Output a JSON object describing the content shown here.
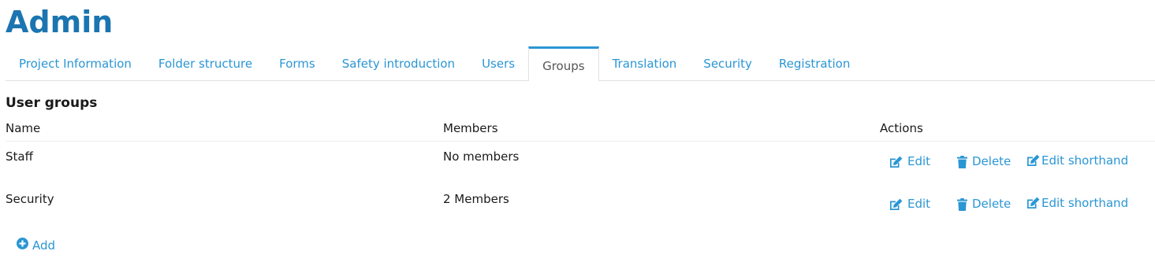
{
  "header": {
    "title": "Admin"
  },
  "tabs": [
    {
      "label": "Project Information",
      "active": false
    },
    {
      "label": "Folder structure",
      "active": false
    },
    {
      "label": "Forms",
      "active": false
    },
    {
      "label": "Safety introduction",
      "active": false
    },
    {
      "label": "Users",
      "active": false
    },
    {
      "label": "Groups",
      "active": true
    },
    {
      "label": "Translation",
      "active": false
    },
    {
      "label": "Security",
      "active": false
    },
    {
      "label": "Registration",
      "active": false
    }
  ],
  "section": {
    "title": "User groups"
  },
  "table": {
    "columns": {
      "name": "Name",
      "members": "Members",
      "actions": "Actions"
    },
    "rows": [
      {
        "name": "Staff",
        "members": "No members"
      },
      {
        "name": "Security",
        "members": "2 Members"
      }
    ]
  },
  "actions": {
    "edit": "Edit",
    "delete": "Delete",
    "edit_shorthand": "Edit shorthand"
  },
  "add": {
    "label": "Add"
  },
  "colors": {
    "title": "#1b75b0",
    "link": "#2a96d4",
    "active_tab_text": "#555555"
  },
  "icons": {
    "edit": "edit-icon",
    "delete": "trash-icon",
    "edit_shorthand": "edit-icon",
    "add": "plus-circle-icon"
  }
}
